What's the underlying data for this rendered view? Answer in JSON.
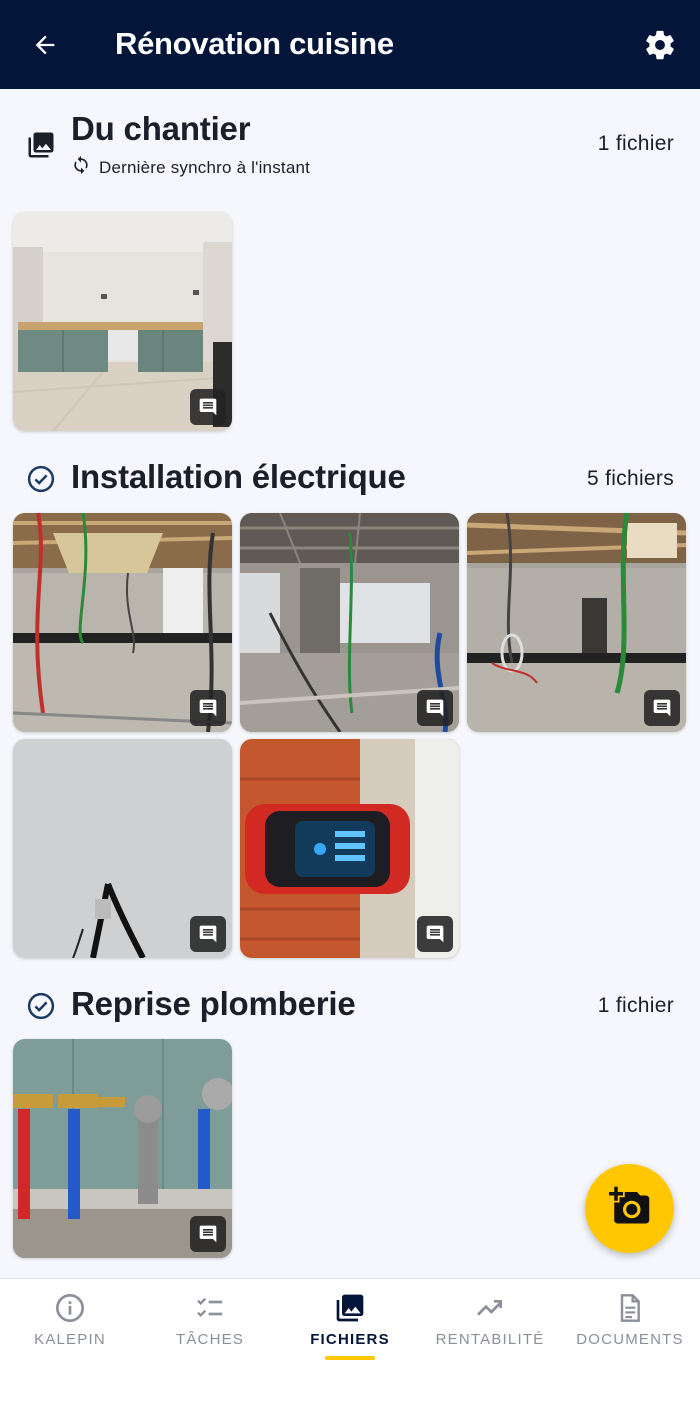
{
  "header": {
    "title": "Rénovation cuisine",
    "back_icon": "arrow-left-icon",
    "settings_icon": "gear-icon"
  },
  "sections": [
    {
      "title": "Du chantier",
      "count": "1 fichier",
      "icon": "photo-library-icon",
      "sync_text": "Dernière synchro à l'instant"
    },
    {
      "title": "Installation électrique",
      "count": "5 fichiers",
      "icon": "check-circle-icon"
    },
    {
      "title": "Reprise plomberie",
      "count": "1 fichier",
      "icon": "check-circle-icon"
    }
  ],
  "fab": {
    "icon": "add-photo-icon"
  },
  "bottom_nav": {
    "tabs": [
      {
        "label": "KALEPIN",
        "icon": "info-icon"
      },
      {
        "label": "TÂCHES",
        "icon": "checklist-icon"
      },
      {
        "label": "FICHIERS",
        "icon": "photo-library-icon",
        "active": true
      },
      {
        "label": "RENTABILITÉ",
        "icon": "trending-up-icon"
      },
      {
        "label": "DOCUMENTS",
        "icon": "document-icon"
      }
    ]
  },
  "colors": {
    "header_bg": "#03163a",
    "accent": "#ffc700",
    "page_bg": "#f6f7fc"
  }
}
